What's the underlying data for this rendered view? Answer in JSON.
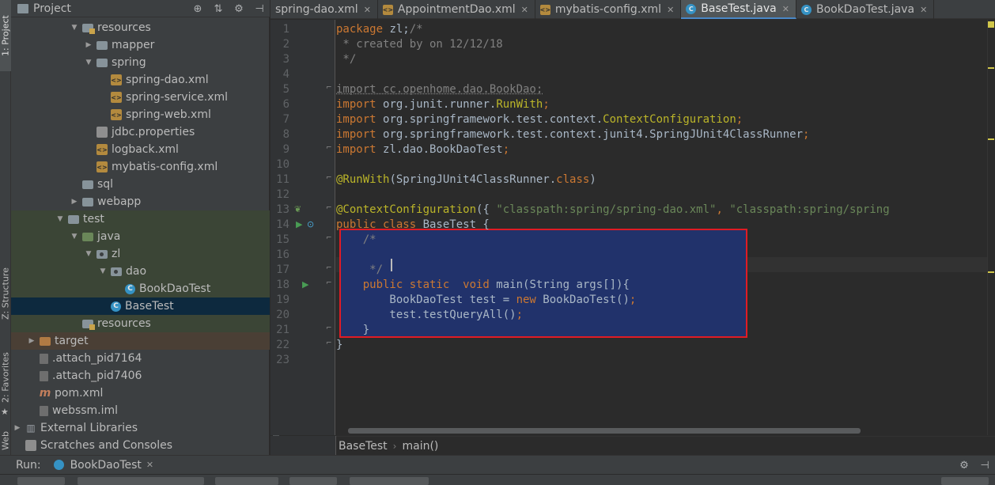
{
  "sidebar": {
    "tabs": [
      {
        "label": "1: Project"
      },
      {
        "label": "Z: Structure"
      },
      {
        "label": "2: Favorites"
      },
      {
        "label": "Web"
      }
    ]
  },
  "project_panel": {
    "title": "Project",
    "tree": [
      {
        "label": "resources",
        "indent": 4,
        "arrow": "down",
        "icon": "folder-res"
      },
      {
        "label": "mapper",
        "indent": 5,
        "arrow": "right",
        "icon": "folder"
      },
      {
        "label": "spring",
        "indent": 5,
        "arrow": "down",
        "icon": "folder"
      },
      {
        "label": "spring-dao.xml",
        "indent": 6,
        "arrow": "",
        "icon": "xml"
      },
      {
        "label": "spring-service.xml",
        "indent": 6,
        "arrow": "",
        "icon": "xml"
      },
      {
        "label": "spring-web.xml",
        "indent": 6,
        "arrow": "",
        "icon": "xml"
      },
      {
        "label": "jdbc.properties",
        "indent": 5,
        "arrow": "",
        "icon": "props"
      },
      {
        "label": "logback.xml",
        "indent": 5,
        "arrow": "",
        "icon": "xml"
      },
      {
        "label": "mybatis-config.xml",
        "indent": 5,
        "arrow": "",
        "icon": "xml"
      },
      {
        "label": "sql",
        "indent": 4,
        "arrow": "",
        "icon": "folder"
      },
      {
        "label": "webapp",
        "indent": 4,
        "arrow": "right",
        "icon": "folder"
      },
      {
        "label": "test",
        "indent": 3,
        "arrow": "down",
        "icon": "folder",
        "bg": "test"
      },
      {
        "label": "java",
        "indent": 4,
        "arrow": "down",
        "icon": "folder-green",
        "bg": "test"
      },
      {
        "label": "zl",
        "indent": 5,
        "arrow": "down",
        "icon": "folder-pkg",
        "bg": "test"
      },
      {
        "label": "dao",
        "indent": 6,
        "arrow": "down",
        "icon": "folder-pkg",
        "bg": "test"
      },
      {
        "label": "BookDaoTest",
        "indent": 7,
        "arrow": "",
        "icon": "javaclass",
        "bg": "test"
      },
      {
        "label": "BaseTest",
        "indent": 6,
        "arrow": "",
        "icon": "javaclass",
        "bg": "selected"
      },
      {
        "label": "resources",
        "indent": 4,
        "arrow": "",
        "icon": "folder-res",
        "bg": "test"
      },
      {
        "label": "target",
        "indent": 1,
        "arrow": "right",
        "icon": "folder-orange",
        "bg": "target"
      },
      {
        "label": ".attach_pid7164",
        "indent": 1,
        "arrow": "",
        "icon": "file"
      },
      {
        "label": ".attach_pid7406",
        "indent": 1,
        "arrow": "",
        "icon": "file"
      },
      {
        "label": "pom.xml",
        "indent": 1,
        "arrow": "",
        "icon": "maven"
      },
      {
        "label": "webssm.iml",
        "indent": 1,
        "arrow": "",
        "icon": "file"
      },
      {
        "label": "External Libraries",
        "indent": 0,
        "arrow": "right",
        "icon": "libs"
      },
      {
        "label": "Scratches and Consoles",
        "indent": 0,
        "arrow": "",
        "icon": "scratch"
      }
    ]
  },
  "editor": {
    "tabs": [
      {
        "label": "spring-dao.xml",
        "icon": "none",
        "active": false
      },
      {
        "label": "AppointmentDao.xml",
        "icon": "xml",
        "active": false
      },
      {
        "label": "mybatis-config.xml",
        "icon": "xml",
        "active": false
      },
      {
        "label": "BaseTest.java",
        "icon": "jclass",
        "active": true
      },
      {
        "label": "BookDaoTest.java",
        "icon": "jclass",
        "active": false
      }
    ],
    "line_numbers": [
      "1",
      "2",
      "3",
      "4",
      "5",
      "6",
      "7",
      "8",
      "9",
      "10",
      "11",
      "12",
      "13",
      "14",
      "15",
      "16",
      "17",
      "18",
      "19",
      "20",
      "21",
      "22",
      "23"
    ],
    "code_lines": [
      [
        {
          "t": "package ",
          "c": "kw"
        },
        {
          "t": "zl;",
          "c": ""
        },
        {
          "t": "/*",
          "c": "cm"
        }
      ],
      [
        {
          "t": " * created by on 12/12/18",
          "c": "cm"
        }
      ],
      [
        {
          "t": " */",
          "c": "cm"
        }
      ],
      [],
      [
        {
          "t": "import cc.openhome.dao.BookDao;",
          "c": "unused"
        }
      ],
      [
        {
          "t": "import ",
          "c": "kw"
        },
        {
          "t": "org.junit.runner.",
          "c": ""
        },
        {
          "t": "RunWith",
          "c": "an"
        },
        {
          "t": ";",
          "c": "kw"
        }
      ],
      [
        {
          "t": "import ",
          "c": "kw"
        },
        {
          "t": "org.springframework.test.context.",
          "c": ""
        },
        {
          "t": "ContextConfiguration",
          "c": "an"
        },
        {
          "t": ";",
          "c": "kw"
        }
      ],
      [
        {
          "t": "import ",
          "c": "kw"
        },
        {
          "t": "org.springframework.test.context.junit4.SpringJUnit4ClassRunner",
          "c": ""
        },
        {
          "t": ";",
          "c": "kw"
        }
      ],
      [
        {
          "t": "import ",
          "c": "kw"
        },
        {
          "t": "zl.dao.BookDaoTest",
          "c": ""
        },
        {
          "t": ";",
          "c": "kw"
        }
      ],
      [],
      [
        {
          "t": "@RunWith",
          "c": "an"
        },
        {
          "t": "(SpringJUnit4ClassRunner.",
          "c": ""
        },
        {
          "t": "class",
          "c": "kw"
        },
        {
          "t": ")",
          "c": ""
        }
      ],
      [],
      [
        {
          "t": "@ContextConfiguration",
          "c": "an"
        },
        {
          "t": "({ ",
          "c": ""
        },
        {
          "t": "\"classpath:spring/spring-dao.xml\"",
          "c": "st"
        },
        {
          "t": ", ",
          "c": "kw"
        },
        {
          "t": "\"classpath:spring/spring",
          "c": "st"
        }
      ],
      [
        {
          "t": "public class ",
          "c": "kw"
        },
        {
          "t": "BaseTest {",
          "c": ""
        }
      ],
      [
        {
          "t": "    /*",
          "c": "cm"
        }
      ],
      [],
      [
        {
          "t": "     */",
          "c": "cm"
        }
      ],
      [
        {
          "t": "    public static  void ",
          "c": "kw"
        },
        {
          "t": "main(String args[]){",
          "c": ""
        }
      ],
      [
        {
          "t": "        BookDaoTest test = ",
          "c": ""
        },
        {
          "t": "new ",
          "c": "kw"
        },
        {
          "t": "BookDaoTest()",
          "c": ""
        },
        {
          "t": ";",
          "c": "kw"
        }
      ],
      [
        {
          "t": "        test.testQueryAll()",
          "c": ""
        },
        {
          "t": ";",
          "c": "kw"
        }
      ],
      [
        {
          "t": "    }",
          "c": ""
        }
      ],
      [
        {
          "t": "}",
          "c": ""
        }
      ],
      []
    ],
    "breadcrumb": [
      "BaseTest",
      "main()"
    ]
  },
  "run_bar": {
    "label": "Run:",
    "tab_label": "BookDaoTest"
  },
  "colors": {
    "selection": "#21326b",
    "highlight_box": "#e01b24",
    "keyword": "#cc7832",
    "annotation": "#bbb529",
    "string": "#6a8759"
  }
}
